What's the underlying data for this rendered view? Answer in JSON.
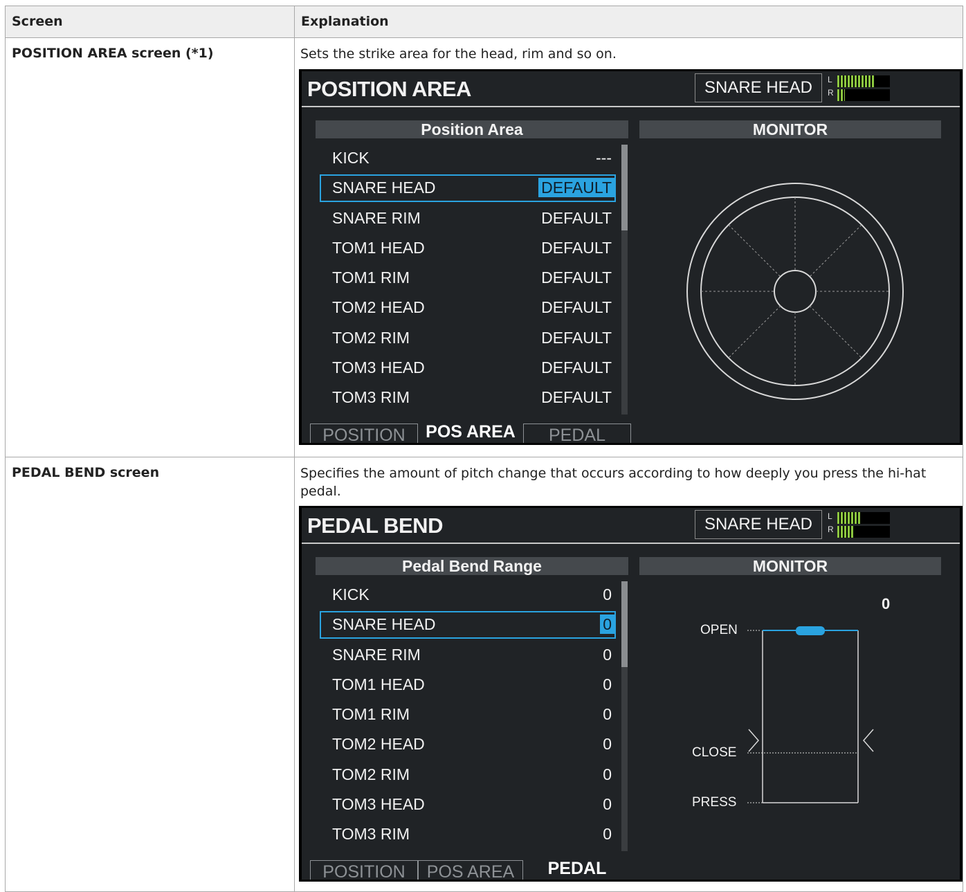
{
  "table": {
    "header_screen": "Screen",
    "header_explanation": "Explanation"
  },
  "rows": [
    {
      "screen": "POSITION AREA screen (*1)",
      "explanation": "Sets the strike area for the head, rim and so on.",
      "device": {
        "title": "POSITION AREA",
        "instrument": "SNARE HEAD",
        "meter": {
          "l_label": "L",
          "r_label": "R",
          "l_level": 0.72,
          "r_level": 0.14
        },
        "list_header": "Position Area",
        "monitor_header": "MONITOR",
        "items": [
          {
            "name": "KICK",
            "value": "---"
          },
          {
            "name": "SNARE HEAD",
            "value": "DEFAULT"
          },
          {
            "name": "SNARE RIM",
            "value": "DEFAULT"
          },
          {
            "name": "TOM1 HEAD",
            "value": "DEFAULT"
          },
          {
            "name": "TOM1 RIM",
            "value": "DEFAULT"
          },
          {
            "name": "TOM2 HEAD",
            "value": "DEFAULT"
          },
          {
            "name": "TOM2 RIM",
            "value": "DEFAULT"
          },
          {
            "name": "TOM3 HEAD",
            "value": "DEFAULT"
          },
          {
            "name": "TOM3 RIM",
            "value": "DEFAULT"
          }
        ],
        "selected_index": 1,
        "tabs": [
          "POSITION",
          "POS AREA",
          "PEDAL BEND"
        ],
        "active_tab": 1
      }
    },
    {
      "screen": "PEDAL BEND screen",
      "explanation": "Specifies the amount of pitch change that occurs according to how deeply you press the hi-hat pedal.",
      "device": {
        "title": "PEDAL BEND",
        "instrument": "SNARE HEAD",
        "meter": {
          "l_label": "L",
          "r_label": "R",
          "l_level": 0.45,
          "r_level": 0.32
        },
        "list_header": "Pedal Bend Range",
        "monitor_header": "MONITOR",
        "monitor_value": "0",
        "monitor_labels": {
          "open": "OPEN",
          "close": "CLOSE",
          "press": "PRESS"
        },
        "items": [
          {
            "name": "KICK",
            "value": "0"
          },
          {
            "name": "SNARE HEAD",
            "value": "0"
          },
          {
            "name": "SNARE RIM",
            "value": "0"
          },
          {
            "name": "TOM1 HEAD",
            "value": "0"
          },
          {
            "name": "TOM1 RIM",
            "value": "0"
          },
          {
            "name": "TOM2 HEAD",
            "value": "0"
          },
          {
            "name": "TOM2 RIM",
            "value": "0"
          },
          {
            "name": "TOM3 HEAD",
            "value": "0"
          },
          {
            "name": "TOM3 RIM",
            "value": "0"
          }
        ],
        "selected_index": 1,
        "tabs": [
          "POSITION",
          "POS AREA",
          "PEDAL BEND"
        ],
        "active_tab": 2
      }
    }
  ],
  "colors": {
    "accent": "#2aa3e0",
    "meter": "#8bc53f",
    "panel_header": "#45494d",
    "screen_bg": "#202326"
  }
}
